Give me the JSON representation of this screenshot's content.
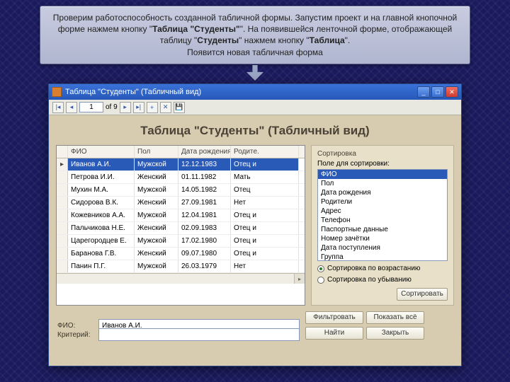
{
  "instruction": {
    "line1_a": "Проверим работоспособность созданной табличной формы. Запустим проект и на главной",
    "line1_b": "кнопочной форме нажмем кнопку \"",
    "bold1": "Таблица \"Студенты\"",
    "line1_c": "\". На появившейся ленточной форме,",
    "line2_a": "отображающей таблицу \"",
    "bold2": "Студенты",
    "line2_b": "\" нажмем кнопку \"",
    "bold3": "Таблица",
    "line2_c": "\".",
    "line3": "Появится новая табличная форма"
  },
  "window": {
    "title": "Таблица \"Студенты\" (Табличный вид)",
    "heading": "Таблица \"Студенты\" (Табличный вид)"
  },
  "nav": {
    "current": "1",
    "of_label": "of 9"
  },
  "table": {
    "columns": {
      "name": "ФИО",
      "gender": "Пол",
      "birth": "Дата рождения",
      "parent": "Родите."
    },
    "rows": [
      {
        "name": "Иванов А.И.",
        "gender": "Мужской",
        "birth": "12.12.1983",
        "parent": "Отец и"
      },
      {
        "name": "Петрова И.И.",
        "gender": "Женский",
        "birth": "01.11.1982",
        "parent": "Мать"
      },
      {
        "name": "Мухин М.А.",
        "gender": "Мужской",
        "birth": "14.05.1982",
        "parent": "Отец"
      },
      {
        "name": "Сидорова В.К.",
        "gender": "Женский",
        "birth": "27.09.1981",
        "parent": "Нет"
      },
      {
        "name": "Кожевников А.А.",
        "gender": "Мужской",
        "birth": "12.04.1981",
        "parent": "Отец и"
      },
      {
        "name": "Пальчикова Н.Е.",
        "gender": "Женский",
        "birth": "02.09.1983",
        "parent": "Отец и"
      },
      {
        "name": "Царегородцев Е.",
        "gender": "Мужской",
        "birth": "17.02.1980",
        "parent": "Отец и"
      },
      {
        "name": "Баранова Г.В.",
        "gender": "Женский",
        "birth": "09.07.1980",
        "parent": "Отец и"
      },
      {
        "name": "Панин П.Г.",
        "gender": "Мужской",
        "birth": "26.03.1979",
        "parent": "Нет"
      }
    ]
  },
  "sort": {
    "group": "Сортировка",
    "field_label": "Поле для сортировки:",
    "fields": [
      "ФИО",
      "Пол",
      "Дата рождения",
      "Родители",
      "Адрес",
      "Телефон",
      "Паспортные данные",
      "Номер зачётки",
      "Дата поступления",
      "Группа"
    ],
    "asc": "Сортировка по возрастанию",
    "desc": "Сортировка по убыванию",
    "button": "Сортировать"
  },
  "bottom": {
    "fio_label": "ФИО:",
    "fio_value": "Иванов А.И.",
    "criteria_label": "Критерий:",
    "criteria_value": "",
    "filter": "Фильтровать",
    "show_all": "Показать всё",
    "find": "Найти",
    "close": "Закрыть"
  }
}
